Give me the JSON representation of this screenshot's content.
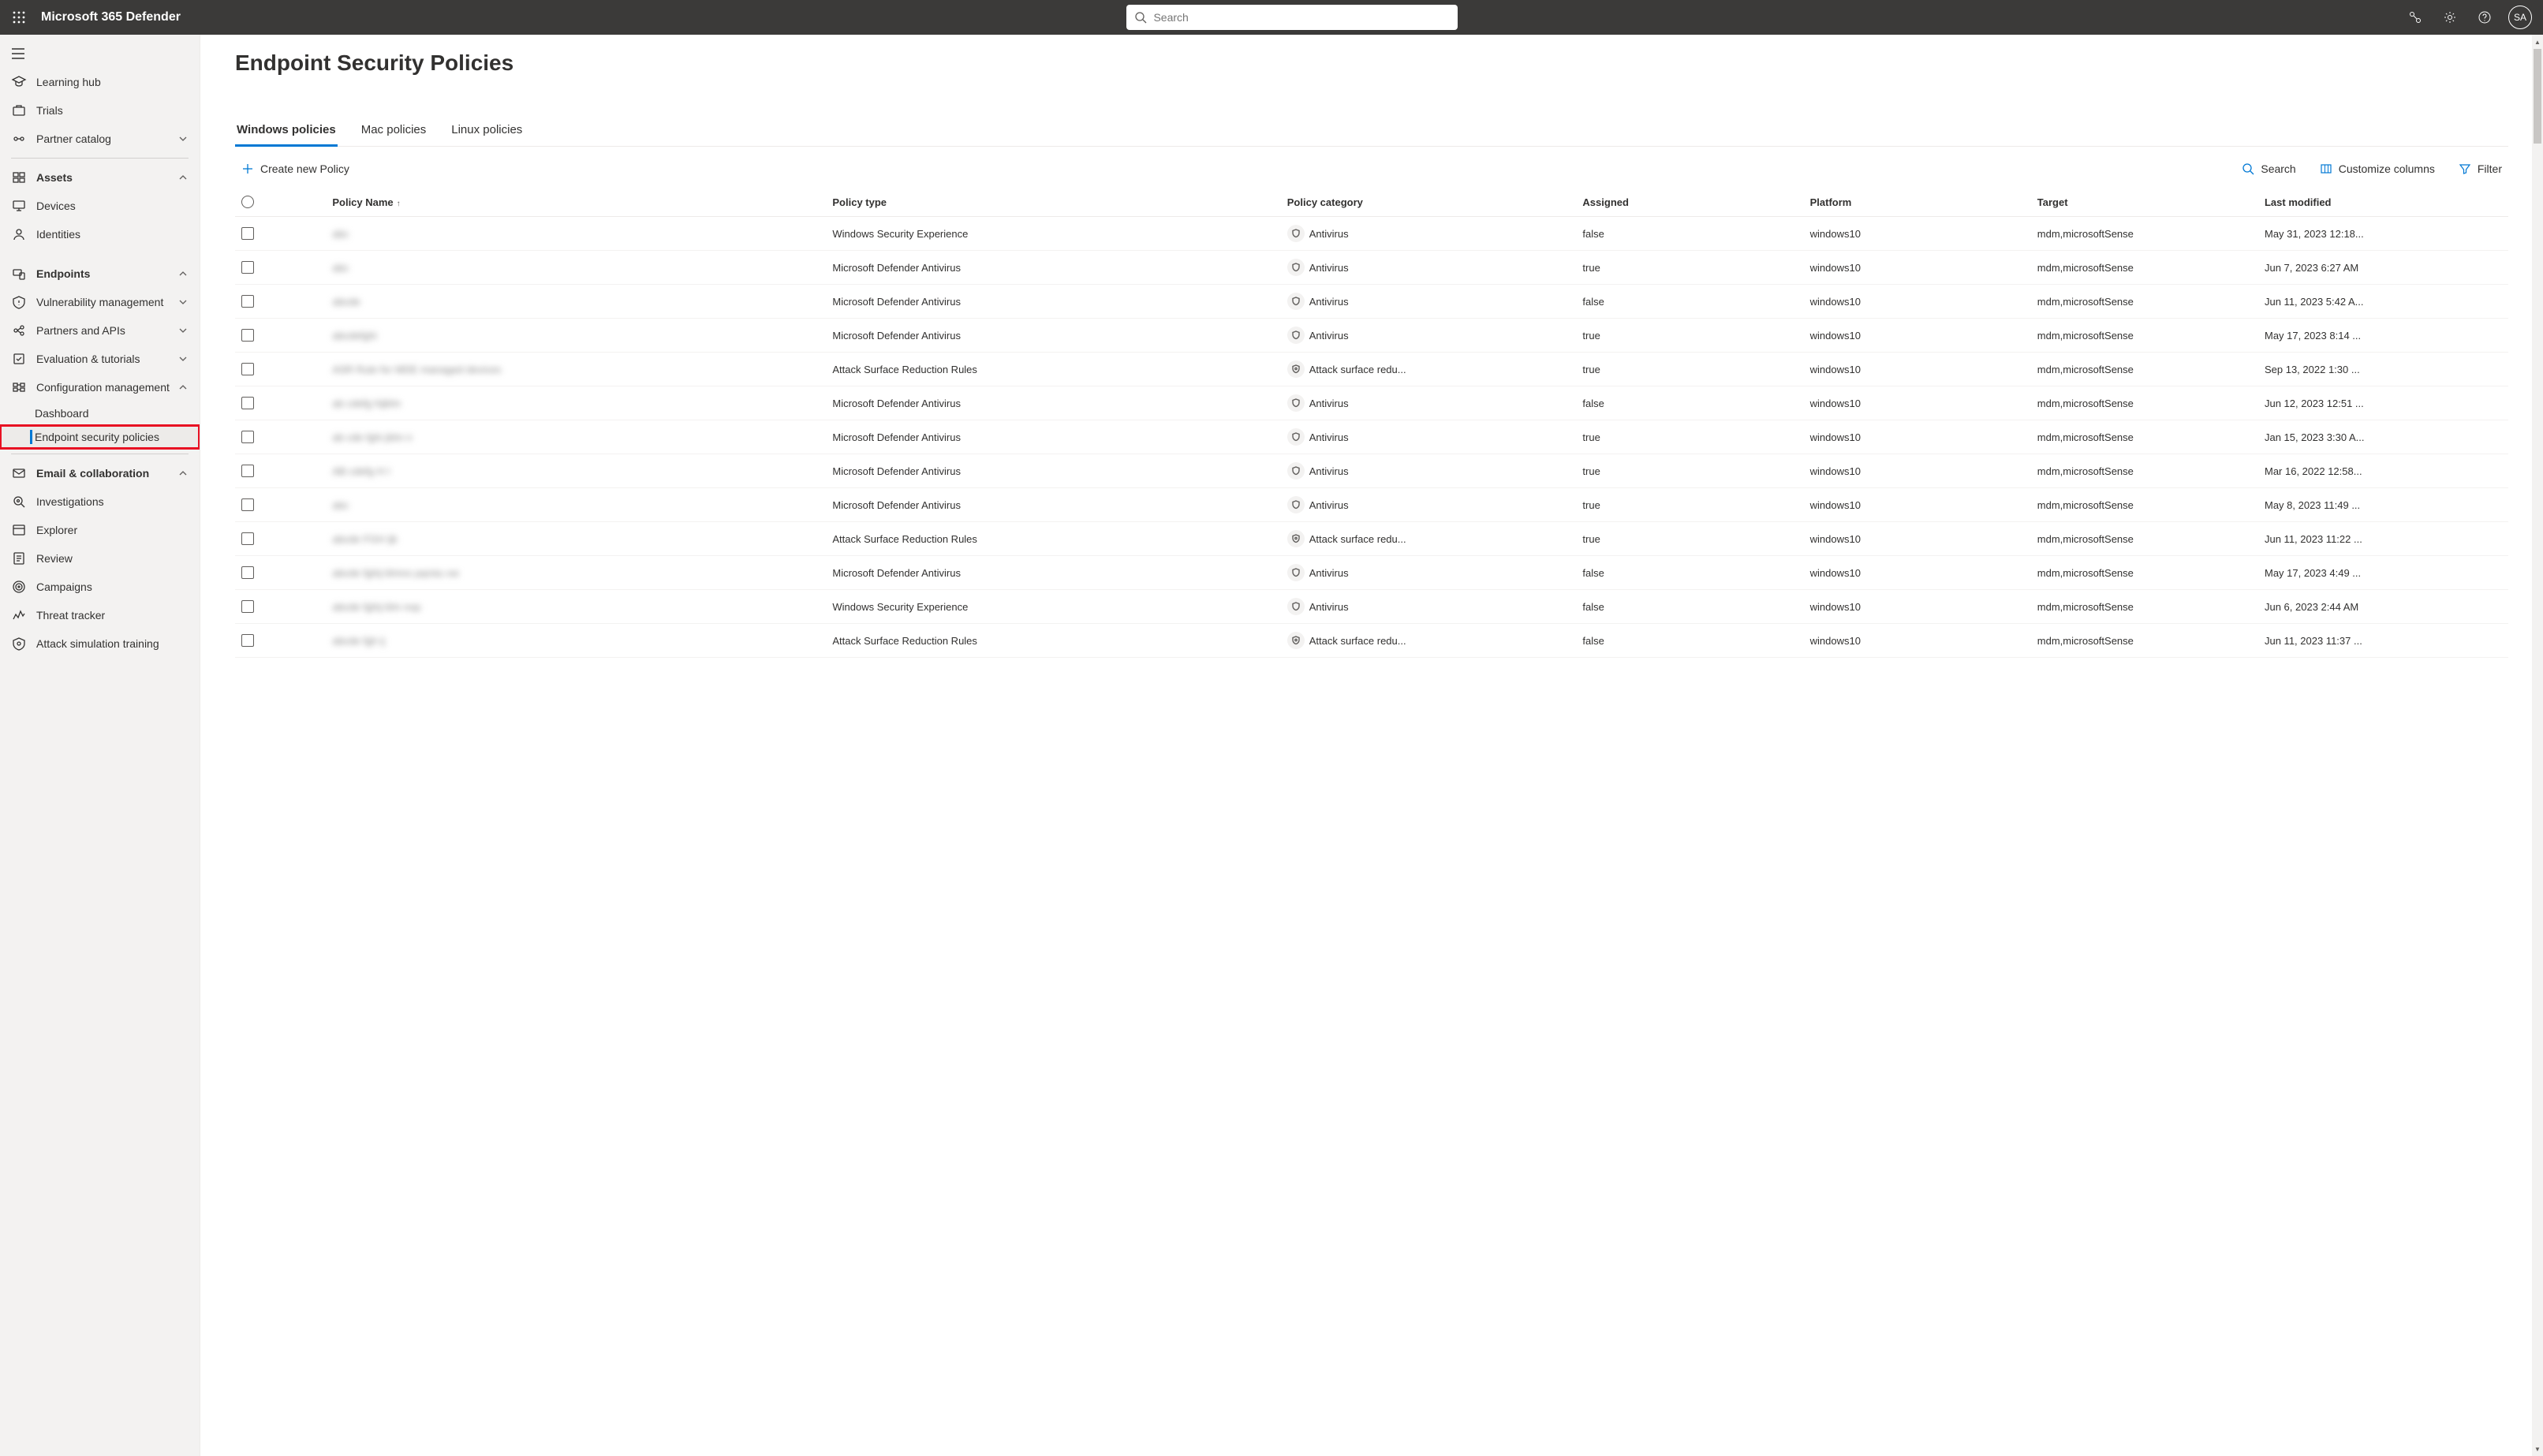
{
  "header": {
    "appTitle": "Microsoft 365 Defender",
    "searchPlaceholder": "Search",
    "avatarInitials": "SA"
  },
  "sidebar": {
    "items": [
      {
        "type": "hamburger"
      },
      {
        "type": "item",
        "icon": "mortarboard",
        "label": "Learning hub"
      },
      {
        "type": "item",
        "icon": "trials",
        "label": "Trials"
      },
      {
        "type": "item",
        "icon": "partner",
        "label": "Partner catalog",
        "chevron": "down"
      },
      {
        "type": "divider"
      },
      {
        "type": "section",
        "icon": "assets",
        "label": "Assets",
        "chevron": "up"
      },
      {
        "type": "item",
        "icon": "devices",
        "label": "Devices"
      },
      {
        "type": "item",
        "icon": "identities",
        "label": "Identities"
      },
      {
        "type": "spacer"
      },
      {
        "type": "section",
        "icon": "endpoints",
        "label": "Endpoints",
        "chevron": "up"
      },
      {
        "type": "item",
        "icon": "vuln",
        "label": "Vulnerability management",
        "chevron": "down"
      },
      {
        "type": "item",
        "icon": "api",
        "label": "Partners and APIs",
        "chevron": "down"
      },
      {
        "type": "item",
        "icon": "eval",
        "label": "Evaluation & tutorials",
        "chevron": "down"
      },
      {
        "type": "item",
        "icon": "config",
        "label": "Configuration management",
        "chevron": "up"
      },
      {
        "type": "sub",
        "label": "Dashboard"
      },
      {
        "type": "sub",
        "label": "Endpoint security policies",
        "active": true,
        "highlighted": true
      },
      {
        "type": "divider"
      },
      {
        "type": "section",
        "icon": "email",
        "label": "Email & collaboration",
        "chevron": "up"
      },
      {
        "type": "item",
        "icon": "investigations",
        "label": "Investigations"
      },
      {
        "type": "item",
        "icon": "explorer",
        "label": "Explorer"
      },
      {
        "type": "item",
        "icon": "review",
        "label": "Review"
      },
      {
        "type": "item",
        "icon": "campaigns",
        "label": "Campaigns"
      },
      {
        "type": "item",
        "icon": "threat",
        "label": "Threat tracker"
      },
      {
        "type": "item",
        "icon": "attack",
        "label": "Attack simulation training"
      }
    ]
  },
  "page": {
    "title": "Endpoint Security Policies",
    "tabs": [
      {
        "label": "Windows policies",
        "active": true
      },
      {
        "label": "Mac policies"
      },
      {
        "label": "Linux policies"
      }
    ],
    "toolbar": {
      "create": "Create new Policy",
      "search": "Search",
      "customize": "Customize columns",
      "filter": "Filter"
    },
    "columns": [
      "Policy Name",
      "Policy type",
      "Policy category",
      "Assigned",
      "Platform",
      "Target",
      "Last modified"
    ],
    "rows": [
      {
        "name": "abc",
        "type": "Windows Security Experience",
        "catIcon": "shield",
        "category": "Antivirus",
        "assigned": "false",
        "platform": "windows10",
        "target": "mdm,microsoftSense",
        "modified": "May 31, 2023 12:18..."
      },
      {
        "name": "abc",
        "type": "Microsoft Defender Antivirus",
        "catIcon": "shield",
        "category": "Antivirus",
        "assigned": "true",
        "platform": "windows10",
        "target": "mdm,microsoftSense",
        "modified": "Jun 7, 2023 6:27 AM"
      },
      {
        "name": "abcde",
        "type": "Microsoft Defender Antivirus",
        "catIcon": "shield",
        "category": "Antivirus",
        "assigned": "false",
        "platform": "windows10",
        "target": "mdm,microsoftSense",
        "modified": "Jun 11, 2023 5:42 A..."
      },
      {
        "name": "abcdefghi",
        "type": "Microsoft Defender Antivirus",
        "catIcon": "shield",
        "category": "Antivirus",
        "assigned": "true",
        "platform": "windows10",
        "target": "mdm,microsoftSense",
        "modified": "May 17, 2023 8:14 ..."
      },
      {
        "name": "ASR Rule for MDE managed devices",
        "type": "Attack Surface Reduction Rules",
        "catIcon": "asr",
        "category": "Attack surface redu...",
        "assigned": "true",
        "platform": "windows10",
        "target": "mdm,microsoftSense",
        "modified": "Sep 13, 2022 1:30 ..."
      },
      {
        "name": "ab cdefg hijklm",
        "type": "Microsoft Defender Antivirus",
        "catIcon": "shield",
        "category": "Antivirus",
        "assigned": "false",
        "platform": "windows10",
        "target": "mdm,microsoftSense",
        "modified": "Jun 12, 2023 12:51 ..."
      },
      {
        "name": "ab cde fghi jklm n",
        "type": "Microsoft Defender Antivirus",
        "catIcon": "shield",
        "category": "Antivirus",
        "assigned": "true",
        "platform": "windows10",
        "target": "mdm,microsoftSense",
        "modified": "Jan 15, 2023 3:30 A..."
      },
      {
        "name": "AB cdefg H I",
        "type": "Microsoft Defender Antivirus",
        "catIcon": "shield",
        "category": "Antivirus",
        "assigned": "true",
        "platform": "windows10",
        "target": "mdm,microsoftSense",
        "modified": "Mar 16, 2022 12:58..."
      },
      {
        "name": "abc",
        "type": "Microsoft Defender Antivirus",
        "catIcon": "shield",
        "category": "Antivirus",
        "assigned": "true",
        "platform": "windows10",
        "target": "mdm,microsoftSense",
        "modified": "May 8, 2023 11:49 ..."
      },
      {
        "name": "abcde FGH ijk",
        "type": "Attack Surface Reduction Rules",
        "catIcon": "asr",
        "category": "Attack surface redu...",
        "assigned": "true",
        "platform": "windows10",
        "target": "mdm,microsoftSense",
        "modified": "Jun 11, 2023 11:22 ..."
      },
      {
        "name": "abcde fghij klmno pqrstu vw",
        "type": "Microsoft Defender Antivirus",
        "catIcon": "shield",
        "category": "Antivirus",
        "assigned": "false",
        "platform": "windows10",
        "target": "mdm,microsoftSense",
        "modified": "May 17, 2023 4:49 ..."
      },
      {
        "name": "abcde fghij klm nop",
        "type": "Windows Security Experience",
        "catIcon": "shield",
        "category": "Antivirus",
        "assigned": "false",
        "platform": "windows10",
        "target": "mdm,microsoftSense",
        "modified": "Jun 6, 2023 2:44 AM"
      },
      {
        "name": "abcde fgh ij",
        "type": "Attack Surface Reduction Rules",
        "catIcon": "asr",
        "category": "Attack surface redu...",
        "assigned": "false",
        "platform": "windows10",
        "target": "mdm,microsoftSense",
        "modified": "Jun 11, 2023 11:37 ..."
      }
    ]
  }
}
